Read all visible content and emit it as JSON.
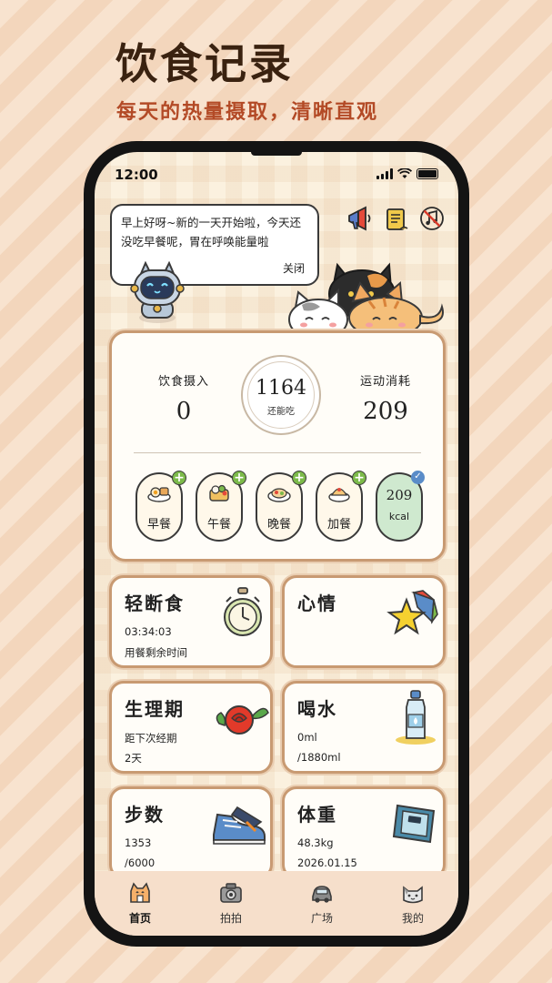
{
  "promo": {
    "title": "饮食记录",
    "subtitle": "每天的热量摄取，清晰直观"
  },
  "status_bar": {
    "time": "12:00"
  },
  "speech_bubble": {
    "text": "早上好呀~新的一天开始啦，今天还没吃早餐呢，胃在呼唤能量啦",
    "close_label": "关闭"
  },
  "header_icons": [
    "megaphone-icon",
    "scroll-icon",
    "music-off-icon"
  ],
  "summary": {
    "intake_label": "饮食摄入",
    "intake_value": "0",
    "remaining_value": "1164",
    "remaining_label": "还能吃",
    "burn_label": "运动消耗",
    "burn_value": "209"
  },
  "meals": [
    {
      "label": "早餐",
      "icon": "breakfast-icon"
    },
    {
      "label": "午餐",
      "icon": "lunch-icon"
    },
    {
      "label": "晚餐",
      "icon": "dinner-icon"
    },
    {
      "label": "加餐",
      "icon": "snack-icon"
    }
  ],
  "exercise_badge": {
    "value": "209",
    "unit": "kcal"
  },
  "cards": {
    "fasting": {
      "title": "轻断食",
      "line1": "03:34:03",
      "line2": "用餐剩余时间"
    },
    "mood": {
      "title": "心情"
    },
    "period": {
      "title": "生理期",
      "line1": "距下次经期",
      "line2": "2天"
    },
    "water": {
      "title": "喝水",
      "line1": "0ml",
      "line2": "/1880ml"
    },
    "steps": {
      "title": "步数",
      "line1": "1353",
      "line2": "/6000"
    },
    "weight": {
      "title": "体重",
      "line1": "48.3kg",
      "line2": "2026.01.15"
    }
  },
  "tabs": [
    {
      "label": "首页",
      "icon": "home-cat-icon",
      "active": true
    },
    {
      "label": "拍拍",
      "icon": "camera-icon",
      "active": false
    },
    {
      "label": "广场",
      "icon": "car-icon",
      "active": false
    },
    {
      "label": "我的",
      "icon": "cat-face-icon",
      "active": false
    }
  ],
  "colors": {
    "accent": "#b34a26",
    "card_border": "#c89a72",
    "plus_green": "#7cba4a",
    "kcal_bg": "#cfe9cf"
  }
}
